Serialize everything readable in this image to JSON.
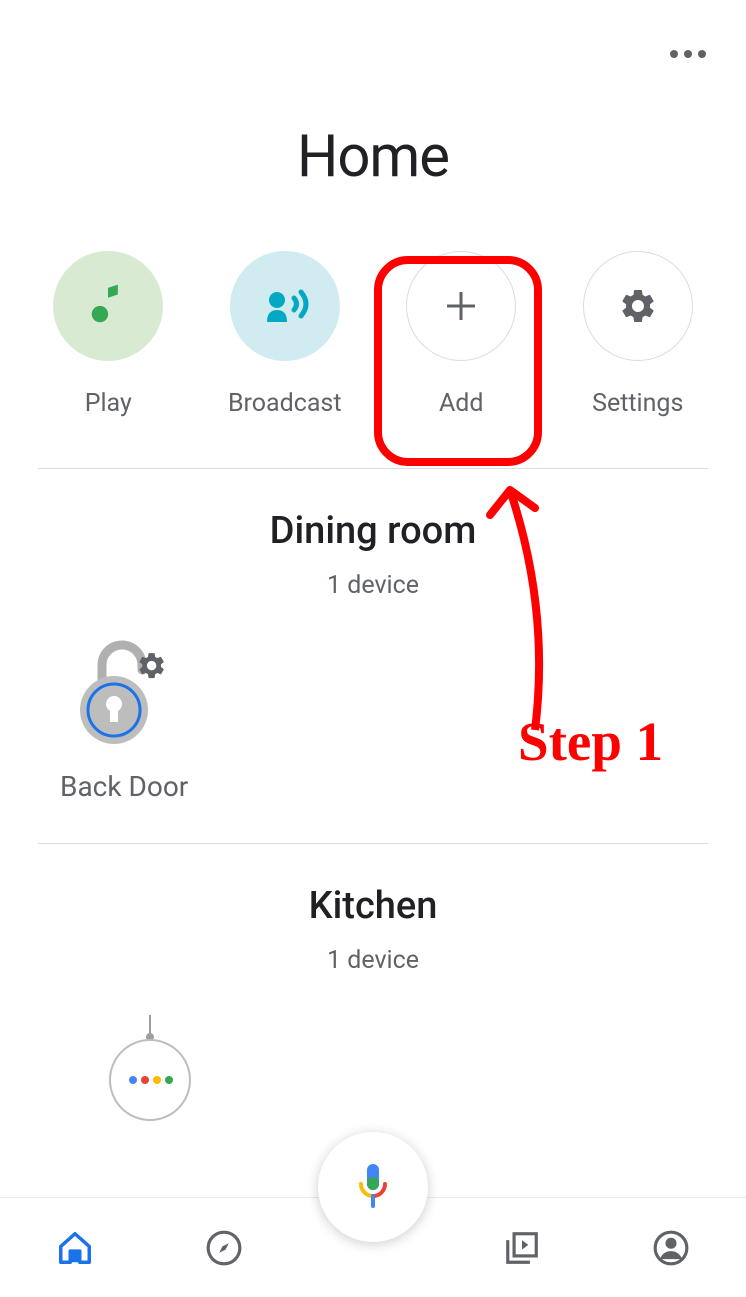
{
  "header": {
    "title": "Home"
  },
  "actions": [
    {
      "label": "Play",
      "icon": "music-note",
      "style": "green"
    },
    {
      "label": "Broadcast",
      "icon": "broadcast",
      "style": "blue"
    },
    {
      "label": "Add",
      "icon": "plus",
      "style": "outlined"
    },
    {
      "label": "Settings",
      "icon": "gear",
      "style": "outlined"
    }
  ],
  "rooms": [
    {
      "name": "Dining room",
      "subtitle": "1 device",
      "devices": [
        {
          "name": "Back Door",
          "type": "lock"
        }
      ]
    },
    {
      "name": "Kitchen",
      "subtitle": "1 device",
      "devices": [
        {
          "name": "",
          "type": "speaker"
        }
      ]
    }
  ],
  "annotation": {
    "text": "Step 1"
  }
}
